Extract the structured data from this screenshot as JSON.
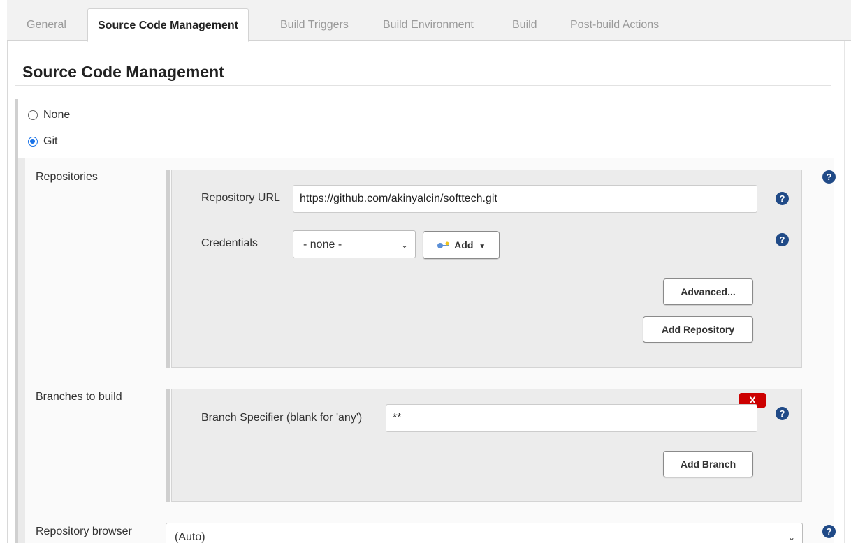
{
  "tabs": [
    {
      "label": "General"
    },
    {
      "label": "Source Code Management"
    },
    {
      "label": "Build Triggers"
    },
    {
      "label": "Build Environment"
    },
    {
      "label": "Build"
    },
    {
      "label": "Post-build Actions"
    }
  ],
  "section": {
    "title": "Source Code Management"
  },
  "scm_options": {
    "none_label": "None",
    "git_label": "Git",
    "selected": "Git"
  },
  "repositories": {
    "label": "Repositories",
    "url_label": "Repository URL",
    "url_value": "https://github.com/akinyalcin/softtech.git",
    "credentials_label": "Credentials",
    "credentials_selected": "- none -",
    "add_label": "Add",
    "advanced_label": "Advanced...",
    "add_repository_label": "Add Repository"
  },
  "branches": {
    "label": "Branches to build",
    "specifier_label": "Branch Specifier (blank for 'any')",
    "specifier_value": "**",
    "remove_label": "X",
    "add_branch_label": "Add Branch"
  },
  "repo_browser": {
    "label": "Repository browser",
    "selected": "(Auto)"
  },
  "help_label": "?",
  "colors": {
    "help": "#204a87",
    "radio_checked": "#1a73e8",
    "remove": "#cc0000"
  }
}
